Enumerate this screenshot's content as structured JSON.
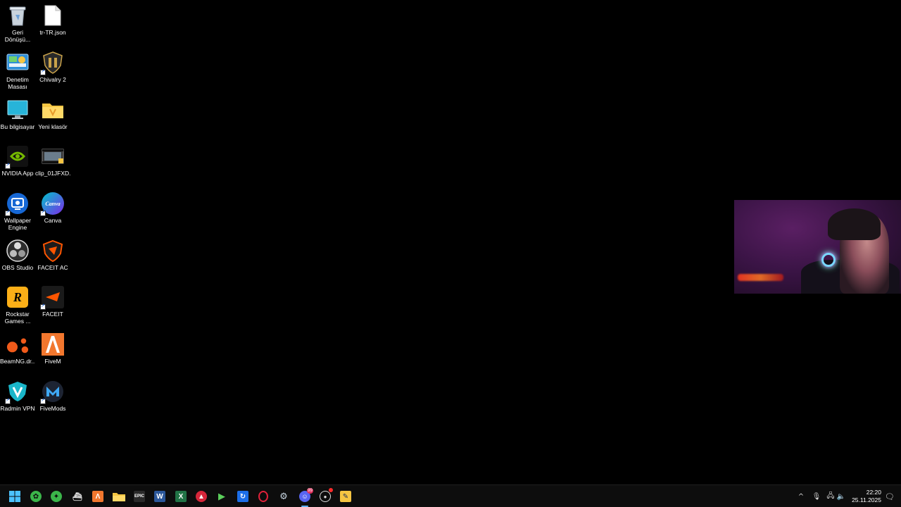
{
  "desktop": {
    "icons_col1": [
      {
        "label": "Geri Dönüşü...",
        "icon": "recycle-bin-icon"
      },
      {
        "label": "Denetim Masası",
        "icon": "control-panel-icon"
      },
      {
        "label": "Bu bilgisayar",
        "icon": "this-pc-icon"
      },
      {
        "label": "NVIDIA App",
        "icon": "nvidia-icon"
      },
      {
        "label": "Wallpaper Engine",
        "icon": "wallpaper-engine-icon"
      },
      {
        "label": "OBS Studio",
        "icon": "obs-icon"
      },
      {
        "label": "Rockstar Games ...",
        "icon": "rockstar-icon"
      },
      {
        "label": "BeamNG.dr...",
        "icon": "beamng-icon"
      },
      {
        "label": "Radmin VPN",
        "icon": "radmin-vpn-icon"
      }
    ],
    "icons_col2": [
      {
        "label": "tr-TR.json",
        "icon": "file-icon"
      },
      {
        "label": "Chivalry 2",
        "icon": "chivalry-icon"
      },
      {
        "label": "Yeni klasör",
        "icon": "folder-icon"
      },
      {
        "label": "clip_01JFXD...",
        "icon": "video-file-icon"
      },
      {
        "label": "Canva",
        "icon": "canva-icon"
      },
      {
        "label": "FACEIT AC",
        "icon": "faceit-ac-icon"
      },
      {
        "label": "FACEIT",
        "icon": "faceit-icon"
      },
      {
        "label": "FiveM",
        "icon": "fivem-icon"
      },
      {
        "label": "FiveMods",
        "icon": "fivemods-icon"
      }
    ],
    "canva_glyph": "Canva",
    "rockstar_glyph": "R"
  },
  "taskbar": {
    "discord_badge": "99",
    "clock_time": "22:20",
    "clock_date": "25.11.2025",
    "tray_chevron": "^"
  }
}
